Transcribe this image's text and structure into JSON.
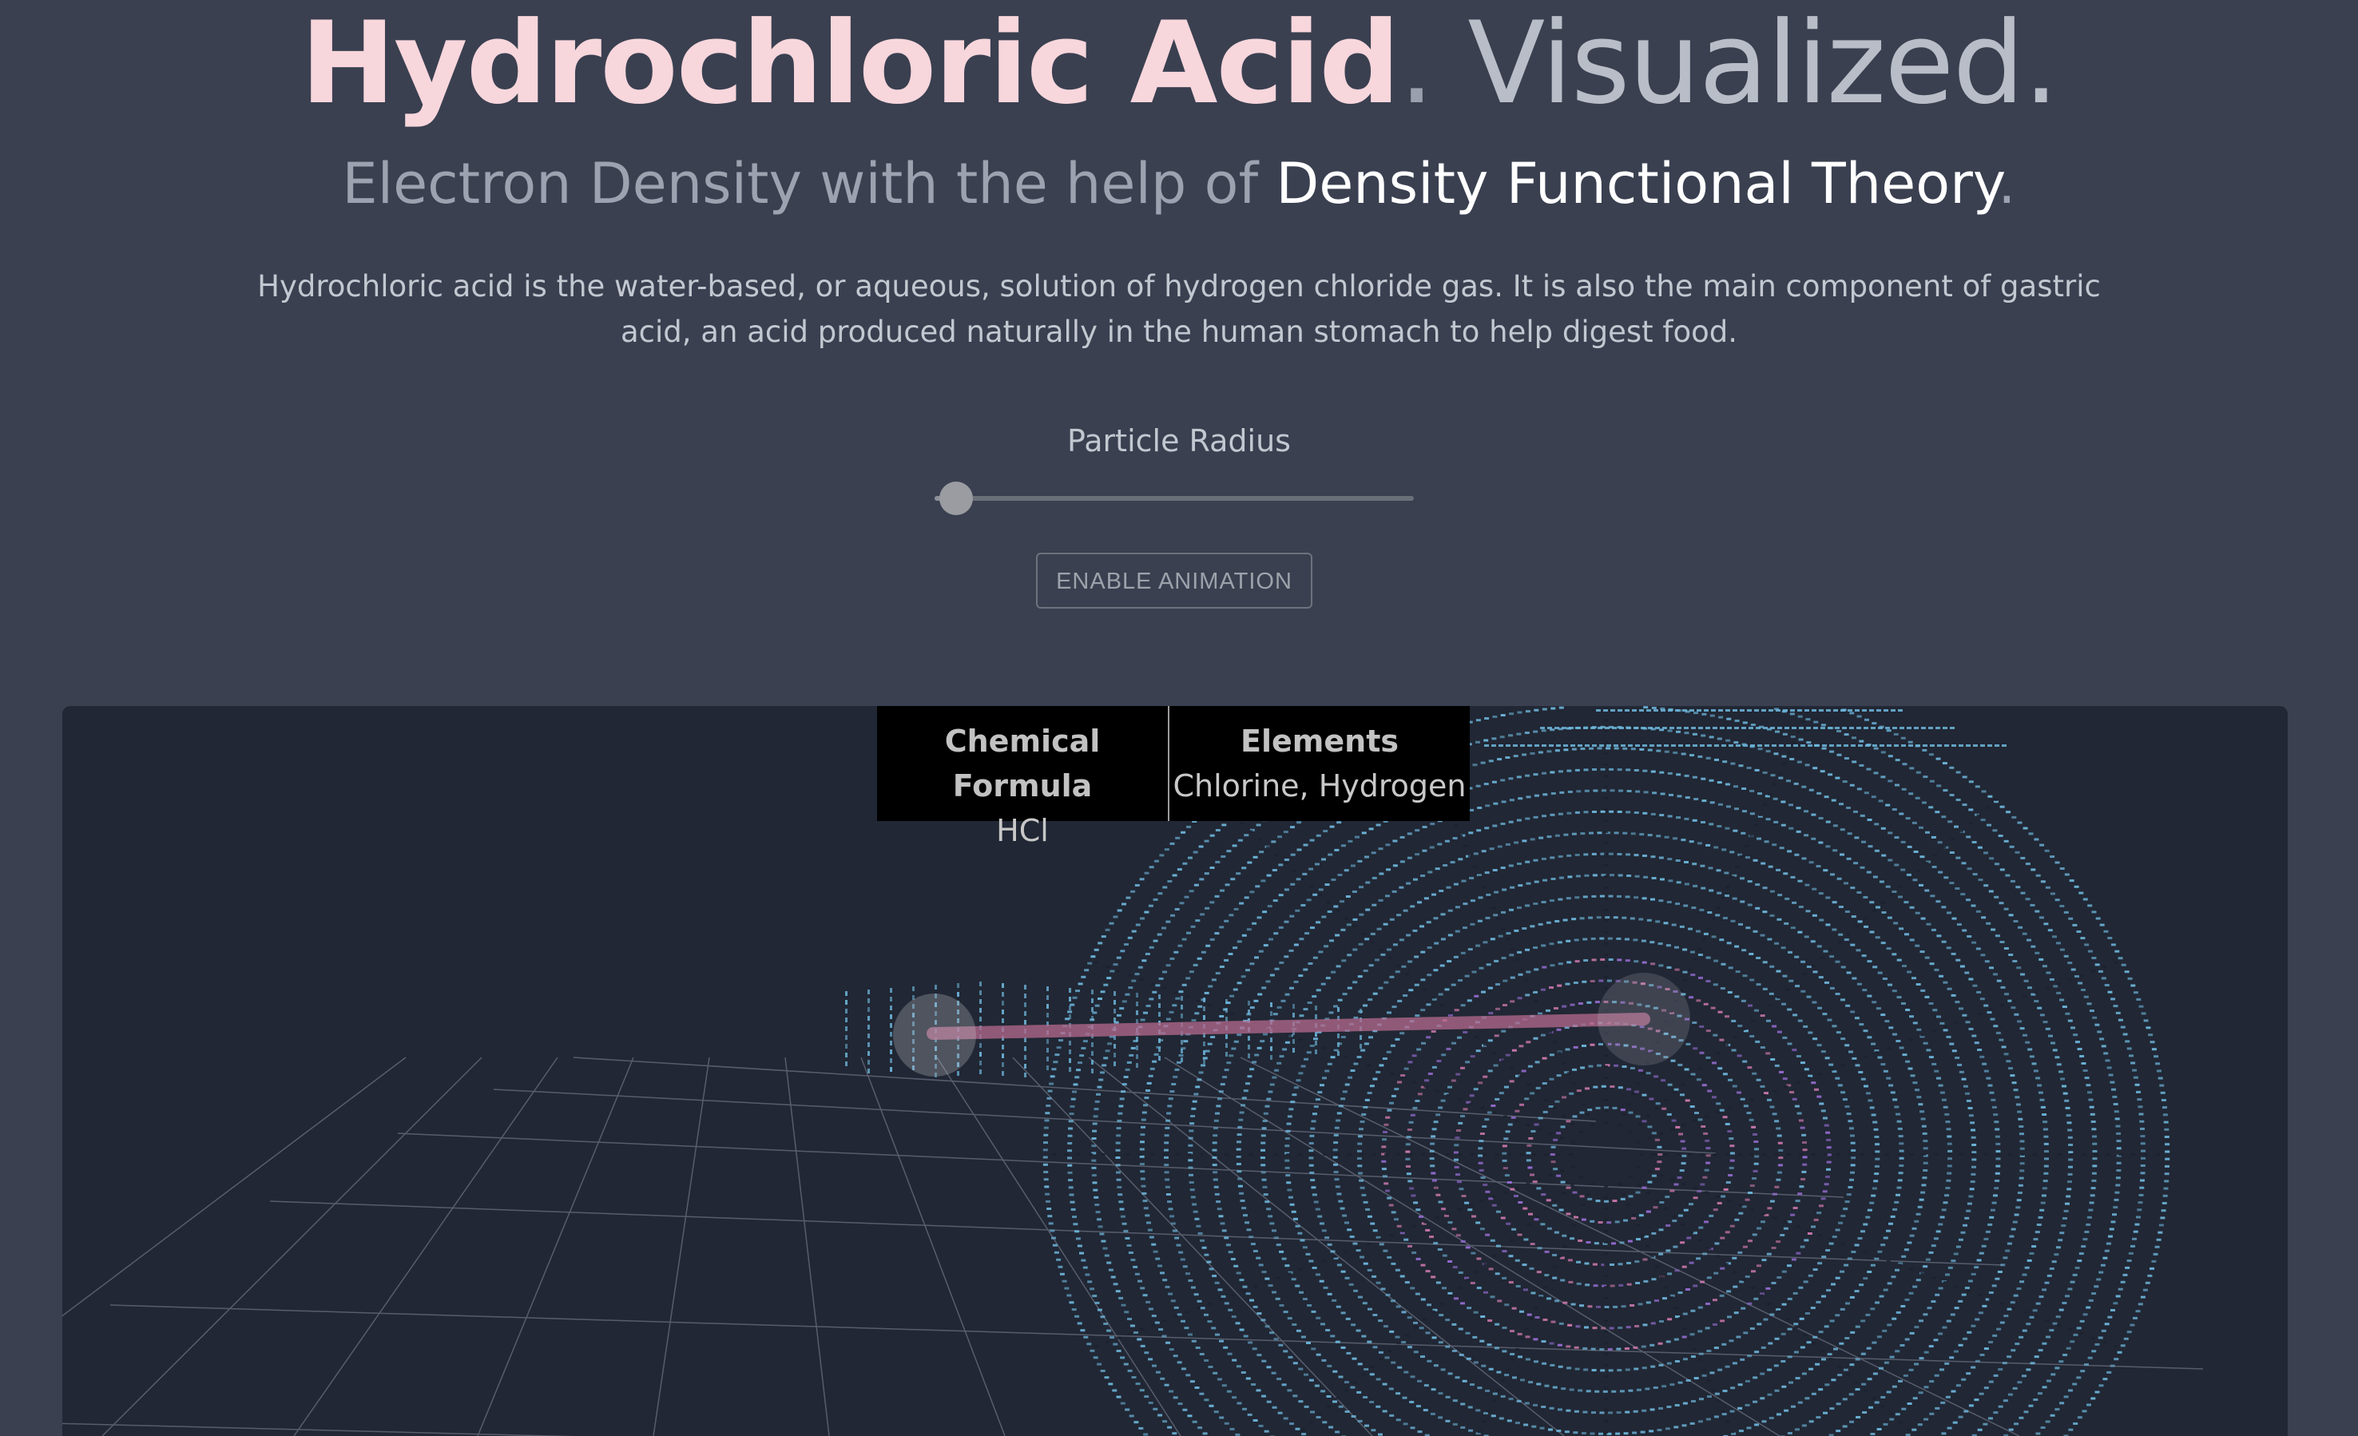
{
  "title": {
    "main": "Hydrochloric Acid",
    "dot1": ".",
    "secondary": " Visualized",
    "dot2": "."
  },
  "subtitle": {
    "prefix": "Electron Density with the help of ",
    "emphasis": "Density Functional Theory",
    "suffix": "."
  },
  "description": "Hydrochloric acid is the water-based, or aqueous, solution of hydrogen chloride gas. It is also the main component of gastric acid, an acid produced naturally in the human stomach to help digest food.",
  "slider": {
    "label": "Particle Radius",
    "value_fraction": 0.045
  },
  "animation_button": {
    "label": "ENABLE ANIMATION"
  },
  "info_table": {
    "formula_header": "Chemical Formula",
    "formula_value": "HCl",
    "elements_header": "Elements",
    "elements_value": "Chlorine, Hydrogen"
  },
  "colors": {
    "background": "#3a4050",
    "viewport_background": "#212734",
    "title_accent": "#f7d6dc",
    "particle": "#6fb8de",
    "bond": "#b56a8e"
  },
  "icons": {
    "slider_thumb": "circle-knob"
  }
}
